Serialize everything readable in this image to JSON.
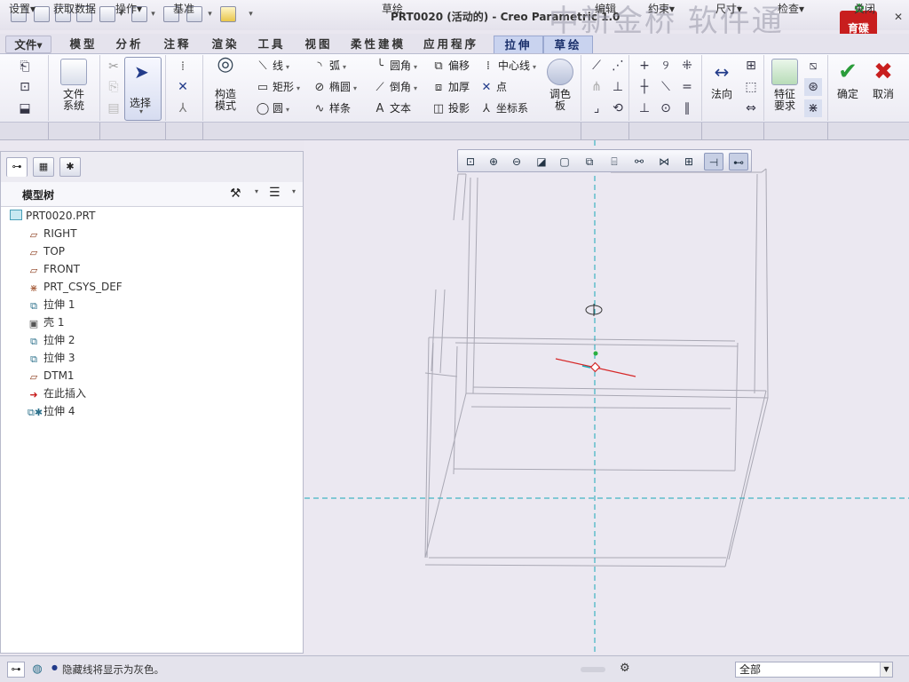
{
  "window": {
    "title": "PRT0020 (活动的) - Creo Parametric 1.0"
  },
  "watermark": "中新金桥 软件通",
  "logo": "育碟\n软件",
  "tabs": [
    {
      "label": "文件▾"
    },
    {
      "label": "模型"
    },
    {
      "label": "分析"
    },
    {
      "label": "注释"
    },
    {
      "label": "渲染"
    },
    {
      "label": "工具"
    },
    {
      "label": "视图"
    },
    {
      "label": "柔性建模"
    },
    {
      "label": "应用程序"
    },
    {
      "label": "拉伸"
    },
    {
      "label": "草绘"
    }
  ],
  "ribbon": {
    "file_system": "文件\n系统",
    "select": "选择",
    "construction": "构造\n模式",
    "line": "线",
    "arc": "弧",
    "fillet": "圆角",
    "offset": "偏移",
    "centerline": "中心线",
    "rectangle": "矩形",
    "ellipse": "椭圆",
    "chamfer": "倒角",
    "thicken": "加厚",
    "point": "点",
    "circle": "圆",
    "spline": "样条",
    "text": "文本",
    "project": "投影",
    "coord_system": "坐标系",
    "palette": "调色\n板",
    "normal": "法向",
    "feature_req": "特征\n要求",
    "ok": "确定",
    "cancel": "取消"
  },
  "groups": [
    "设置▾",
    "获取数据",
    "操作▾",
    "基准",
    "草绘",
    "编辑",
    "约束▾",
    "尺寸▾",
    "检查▾",
    "关闭"
  ],
  "model_tree": {
    "title": "模型树",
    "items": [
      {
        "label": "PRT0020.PRT",
        "icon": "part-icon"
      },
      {
        "label": "RIGHT",
        "icon": "datum-plane-icon"
      },
      {
        "label": "TOP",
        "icon": "datum-plane-icon"
      },
      {
        "label": "FRONT",
        "icon": "datum-plane-icon"
      },
      {
        "label": "PRT_CSYS_DEF",
        "icon": "csys-icon"
      },
      {
        "label": "拉伸 1",
        "icon": "extrude-icon"
      },
      {
        "label": "壳 1",
        "icon": "shell-icon"
      },
      {
        "label": "拉伸 2",
        "icon": "extrude-icon"
      },
      {
        "label": "拉伸 3",
        "icon": "extrude-icon"
      },
      {
        "label": "DTM1",
        "icon": "datum-plane-icon"
      },
      {
        "label": "在此插入",
        "icon": "insert-here-icon"
      },
      {
        "label": "拉伸 4",
        "icon": "extrude-active-icon"
      }
    ]
  },
  "status": {
    "message": "隐藏线将显示为灰色。",
    "filter": "全部"
  },
  "colors": {
    "accent": "#c9d3ef",
    "ok": "#2a9c3a",
    "cancel": "#c81e1e",
    "axis": "#19a9b8"
  }
}
